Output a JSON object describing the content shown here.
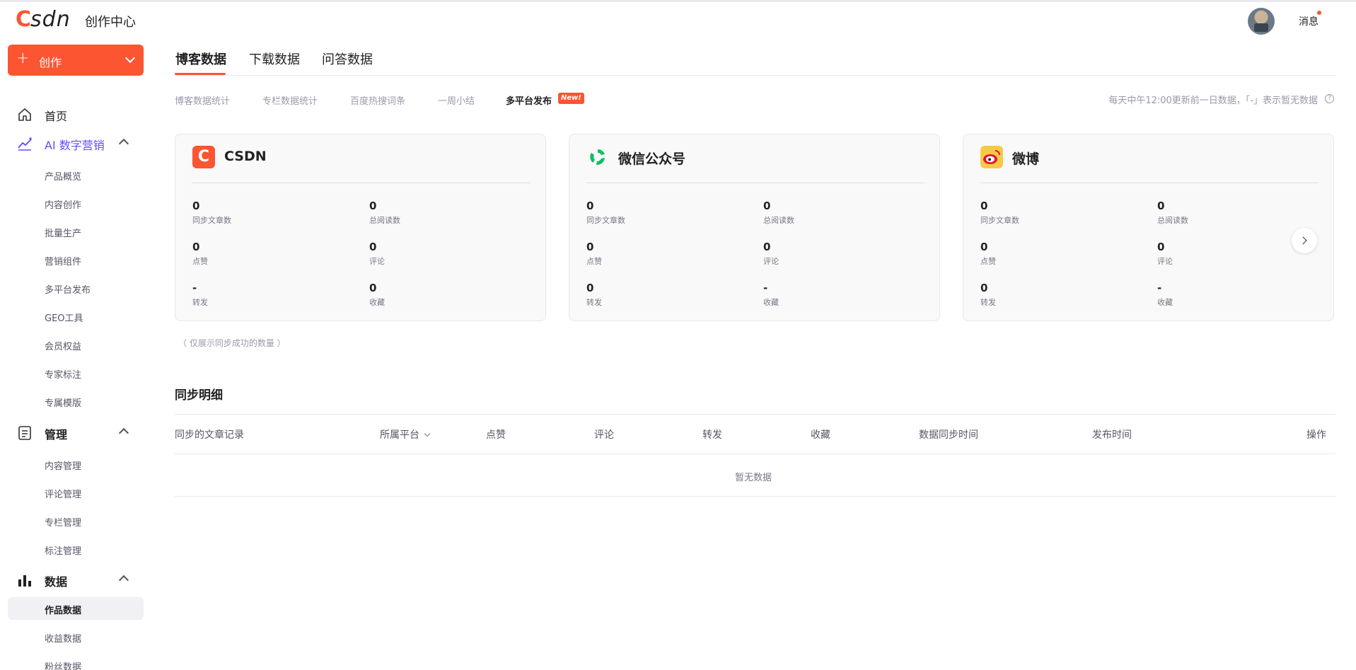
{
  "header": {
    "logo_c": "C",
    "logo_rest": "SDN",
    "title": "创作中心",
    "messages_label": "消息"
  },
  "sidebar": {
    "create_label": "创作",
    "home_label": "首页",
    "ai_section": {
      "label": "AI 数字营销",
      "items": [
        "产品概览",
        "内容创作",
        "批量生产",
        "营销组件",
        "多平台发布",
        "GEO工具",
        "会员权益",
        "专家标注",
        "专属模版"
      ]
    },
    "manage_section": {
      "label": "管理",
      "items": [
        "内容管理",
        "评论管理",
        "专栏管理",
        "标注管理"
      ]
    },
    "data_section": {
      "label": "数据",
      "items": [
        "作品数据",
        "收益数据",
        "粉丝数据"
      ],
      "active_item": "作品数据"
    }
  },
  "tabs": [
    "博客数据",
    "下载数据",
    "问答数据"
  ],
  "active_tab": "博客数据",
  "subtabs": [
    "博客数据统计",
    "专栏数据统计",
    "百度热搜词条",
    "一周小结",
    "多平台发布"
  ],
  "active_subtab": "多平台发布",
  "new_badge": "New!",
  "notice": "每天中午12:00更新前一日数据，「-」表示暂无数据",
  "cards": [
    {
      "name": "CSDN",
      "logo_char": "C",
      "stats": [
        {
          "value": "0",
          "label": "同步文章数"
        },
        {
          "value": "0",
          "label": "总阅读数"
        },
        {
          "value": "0",
          "label": "点赞"
        },
        {
          "value": "0",
          "label": "评论"
        },
        {
          "value": "-",
          "label": "转发"
        },
        {
          "value": "0",
          "label": "收藏"
        }
      ]
    },
    {
      "name": "微信公众号",
      "stats": [
        {
          "value": "0",
          "label": "同步文章数"
        },
        {
          "value": "0",
          "label": "总阅读数"
        },
        {
          "value": "0",
          "label": "点赞"
        },
        {
          "value": "0",
          "label": "评论"
        },
        {
          "value": "0",
          "label": "转发"
        },
        {
          "value": "-",
          "label": "收藏"
        }
      ]
    },
    {
      "name": "微博",
      "stats": [
        {
          "value": "0",
          "label": "同步文章数"
        },
        {
          "value": "0",
          "label": "总阅读数"
        },
        {
          "value": "0",
          "label": "点赞"
        },
        {
          "value": "0",
          "label": "评论"
        },
        {
          "value": "0",
          "label": "转发"
        },
        {
          "value": "-",
          "label": "收藏"
        }
      ]
    }
  ],
  "hint": "（ 仅展示同步成功的数量 ）",
  "detail": {
    "title": "同步明细",
    "columns": [
      "同步的文章记录",
      "所属平台",
      "点赞",
      "评论",
      "转发",
      "收藏",
      "数据同步时间",
      "发布时间",
      "操作"
    ],
    "empty_text": "暂无数据"
  },
  "colors": {
    "accent": "#fc5531",
    "ai_purple": "#5f4dff",
    "wechat_green": "#07c160",
    "weibo_yellow": "#f7c948"
  }
}
